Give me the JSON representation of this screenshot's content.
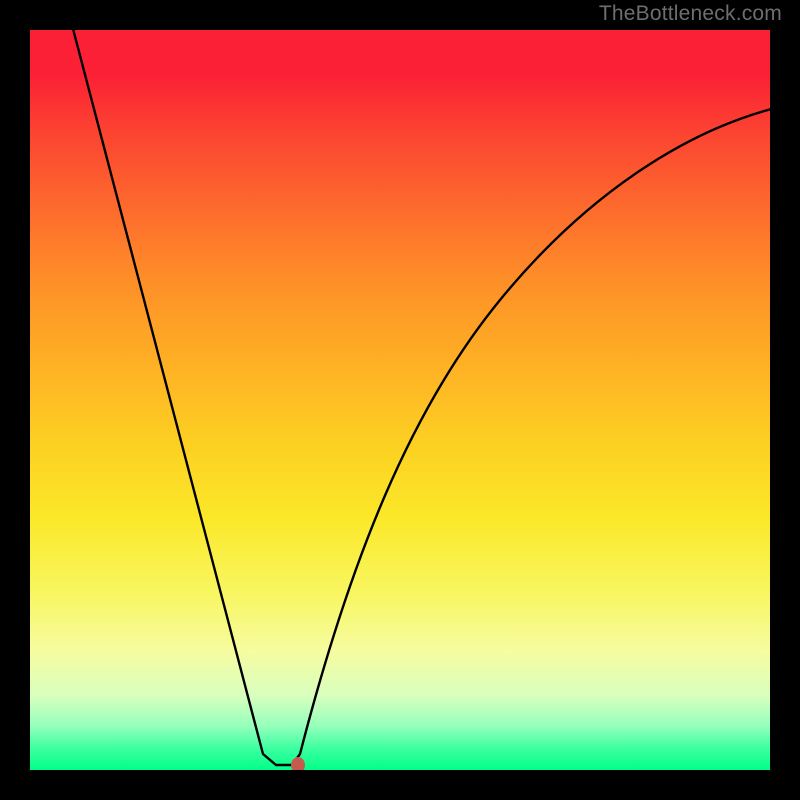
{
  "watermark": "TheBottleneck.com",
  "chart_data": {
    "type": "line",
    "title": "",
    "xlabel": "",
    "ylabel": "",
    "xlim": [
      0,
      100
    ],
    "ylim": [
      0,
      100
    ],
    "grid": false,
    "legend": false,
    "background_gradient": {
      "direction": "vertical",
      "stops": [
        {
          "pos": 0,
          "color": "#fb2035"
        },
        {
          "pos": 50,
          "color": "#fdd323"
        },
        {
          "pos": 85,
          "color": "#f6fca1"
        },
        {
          "pos": 100,
          "color": "#00ff88"
        }
      ]
    },
    "series": [
      {
        "name": "bottleneck-curve",
        "color": "#000000",
        "x": [
          5,
          10,
          15,
          20,
          25,
          30,
          32,
          34,
          36,
          38,
          40,
          45,
          50,
          55,
          60,
          65,
          70,
          75,
          80,
          85,
          90,
          95,
          100
        ],
        "y": [
          100,
          81,
          62,
          43,
          24,
          5,
          1,
          0,
          0,
          3,
          10,
          28,
          42,
          53,
          62,
          69,
          75,
          79,
          83,
          86,
          88,
          89,
          90
        ]
      }
    ],
    "marker": {
      "name": "optimal-point",
      "x": 36,
      "y": 0,
      "color": "#c65a4c"
    }
  }
}
